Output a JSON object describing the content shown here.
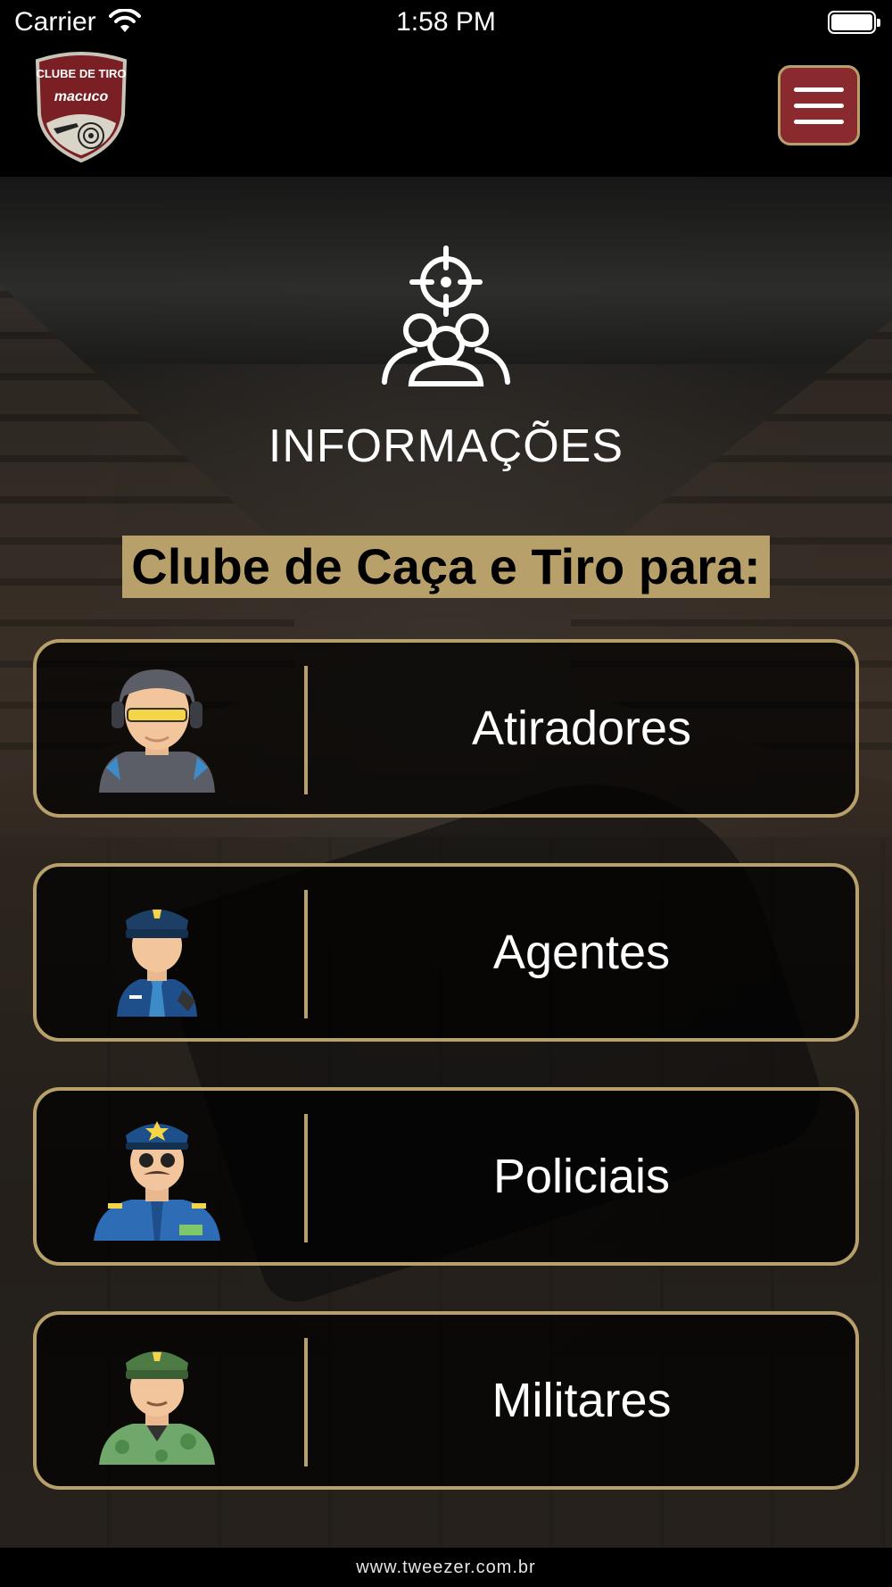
{
  "status_bar": {
    "carrier": "Carrier",
    "time": "1:58 PM"
  },
  "header": {
    "logo_text_line1": "CLUBE DE TIRO",
    "logo_text_line2": "macuco",
    "menu_icon": "hamburger-menu-icon",
    "menu_color": "#8b2a2e",
    "accent_color": "#b8a06a"
  },
  "main": {
    "hero_icon": "target-crowd-icon",
    "title": "INFORMAÇÕES",
    "subtitle": "Clube de Caça e Tiro para:",
    "categories": [
      {
        "label": "Atiradores",
        "icon": "shooter-avatar-icon"
      },
      {
        "label": "Agentes",
        "icon": "agent-avatar-icon"
      },
      {
        "label": "Policiais",
        "icon": "police-avatar-icon"
      },
      {
        "label": "Militares",
        "icon": "military-avatar-icon"
      }
    ]
  },
  "footer": {
    "website": "www.tweezer.com.br"
  }
}
